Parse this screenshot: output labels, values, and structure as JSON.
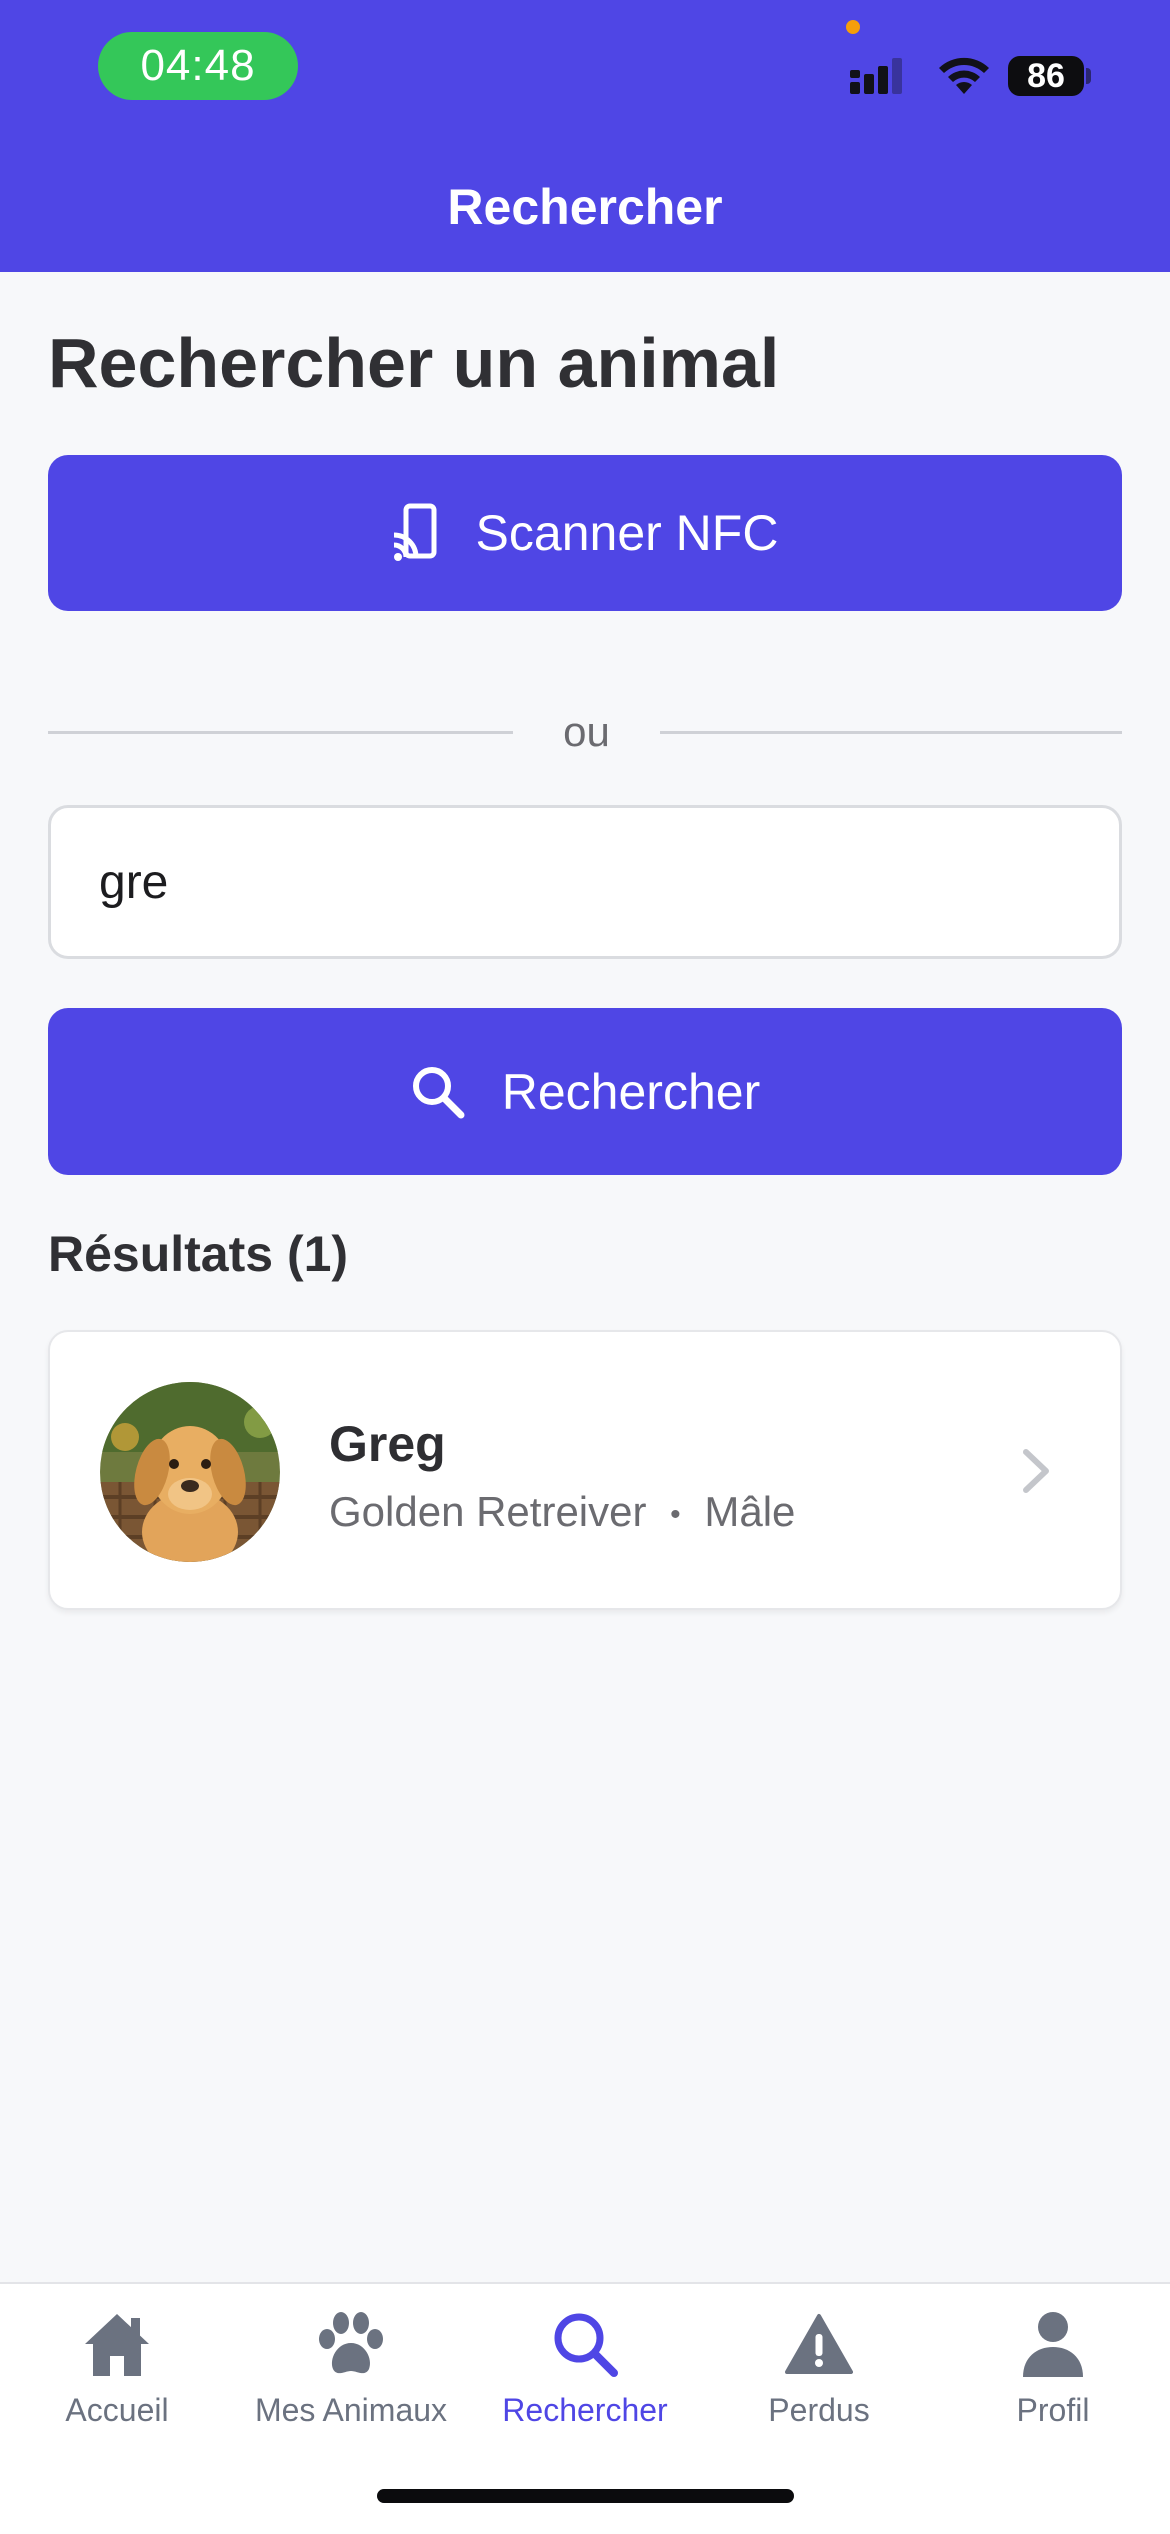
{
  "status_bar": {
    "time": "04:48",
    "battery": "86"
  },
  "header": {
    "title": "Rechercher"
  },
  "main": {
    "page_title": "Rechercher un animal",
    "nfc_button_label": "Scanner NFC",
    "divider_text": "ou",
    "search_value": "gre",
    "search_button_label": "Rechercher",
    "results_title": "Résultats (1)",
    "results": [
      {
        "name": "Greg",
        "breed": "Golden Retreiver",
        "separator": "•",
        "sex": "Mâle"
      }
    ]
  },
  "tabbar": {
    "items": [
      {
        "label": "Accueil",
        "icon": "home-icon",
        "active": false
      },
      {
        "label": "Mes Animaux",
        "icon": "paw-icon",
        "active": false
      },
      {
        "label": "Rechercher",
        "icon": "search-icon",
        "active": true
      },
      {
        "label": "Perdus",
        "icon": "warning-icon",
        "active": false
      },
      {
        "label": "Profil",
        "icon": "user-icon",
        "active": false
      }
    ]
  },
  "colors": {
    "accent": "#4F46E5",
    "status_pill": "#34C759",
    "inactive_tab": "#6B7280",
    "background": "#F7F8FA"
  }
}
